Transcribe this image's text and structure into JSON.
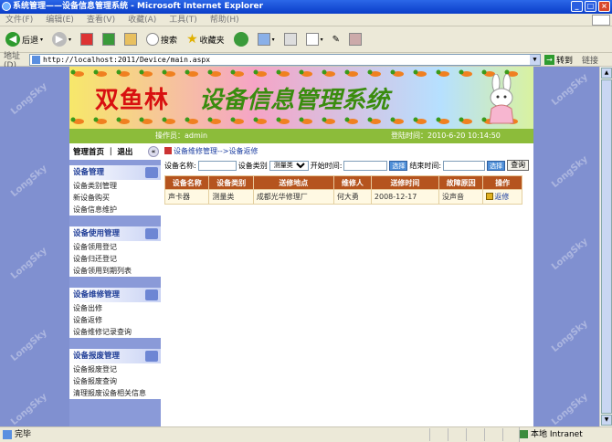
{
  "window": {
    "title": "系统管理——设备信息管理系统 - Microsoft Internet Explorer"
  },
  "menu": [
    "文件(F)",
    "编辑(E)",
    "查看(V)",
    "收藏(A)",
    "工具(T)",
    "帮助(H)"
  ],
  "toolbar": {
    "back": "后退",
    "search": "搜索",
    "favorites": "收藏夹"
  },
  "address": {
    "label": "地址(D)",
    "url": "http://localhost:2011/Device/main.aspx",
    "go": "转到",
    "links": "链接"
  },
  "banner": {
    "part1": "双鱼林",
    "part2": "设备信息管理系统"
  },
  "info": {
    "operator": "操作员：admin",
    "login_time": "登陆时间：2010-6-20 10:14:50"
  },
  "sidebar": {
    "head": "管理首页 ｜ 退出",
    "groups": [
      {
        "title": "设备管理",
        "items": [
          "设备类别管理",
          "新设备购买",
          "设备信息维护"
        ]
      },
      {
        "title": "设备使用管理",
        "items": [
          "设备领用登记",
          "设备归还登记",
          "设备领用到期列表"
        ]
      },
      {
        "title": "设备维修管理",
        "items": [
          "设备出修",
          "设备返修",
          "设备维修记录查询"
        ]
      },
      {
        "title": "设备报废管理",
        "items": [
          "设备报废登记",
          "设备报废查询",
          "清理报废设备相关信息"
        ]
      }
    ]
  },
  "main": {
    "breadcrumb": "设备维修管理-->设备返修",
    "filters": {
      "name_label": "设备名称:",
      "type_label": "设备类别",
      "type_value": "测量类",
      "start_label": "开始时间:",
      "end_label": "结束时间:",
      "pick": "选择",
      "query": "查询"
    },
    "table": {
      "headers": [
        "设备名称",
        "设备类别",
        "送修地点",
        "维修人",
        "送修时间",
        "故障原因",
        "操作"
      ],
      "rows": [
        [
          "声卡器",
          "测量类",
          "成都光华修理厂",
          "何大勇",
          "2008-12-17",
          "没声音",
          "返修"
        ]
      ]
    }
  },
  "status": {
    "done": "完毕",
    "zone": "本地 Intranet"
  },
  "watermark": "LongSky"
}
